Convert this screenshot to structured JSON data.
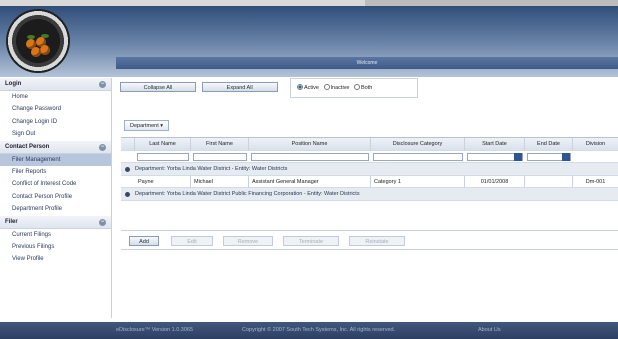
{
  "panel": {
    "title": "Welcome"
  },
  "sidebar": {
    "sections": [
      {
        "title": "Login",
        "items": [
          {
            "label": "Home",
            "active": false
          },
          {
            "label": "Change Password",
            "active": false
          },
          {
            "label": "Change Login ID",
            "active": false
          },
          {
            "label": "Sign Out",
            "active": false
          }
        ]
      },
      {
        "title": "Contact Person",
        "items": [
          {
            "label": "Filer Management",
            "active": true
          },
          {
            "label": "Filer Reports",
            "active": false
          },
          {
            "label": "Conflict of Interest Code",
            "active": false
          },
          {
            "label": "Contact Person Profile",
            "active": false
          },
          {
            "label": "Department Profile",
            "active": false
          }
        ]
      },
      {
        "title": "Filer",
        "items": [
          {
            "label": "Current Filings",
            "active": false
          },
          {
            "label": "Previous Filings",
            "active": false
          },
          {
            "label": "View Profile",
            "active": false
          }
        ]
      }
    ]
  },
  "controls": {
    "collapse_all": "Collapse All",
    "expand_all": "Expand All",
    "status_options": [
      {
        "label": "Active",
        "selected": true
      },
      {
        "label": "Inactive",
        "selected": false
      },
      {
        "label": "Both",
        "selected": false
      }
    ],
    "department_dropdown": "Department"
  },
  "grid": {
    "columns": [
      "Last Name",
      "First Name",
      "Position Name",
      "Disclosure Category",
      "Start Date",
      "End Date",
      "Division"
    ],
    "groups": [
      {
        "label": "Department: Yorba Linda Water District - Entity: Water Districts",
        "rows": [
          [
            "Payne",
            "Michael",
            "Assistant General Manager",
            "Category 1",
            "01/01/2008",
            "",
            "Dm-001"
          ]
        ]
      },
      {
        "label": "Department: Yorba Linda Water District Public Financing Corporation - Entity: Water Districts",
        "rows": []
      }
    ]
  },
  "actions": {
    "add": "Add",
    "edit": "Edit",
    "remove": "Remove",
    "terminate": "Terminate",
    "reinstate": "Reinstate"
  },
  "footer": {
    "product": "eDisclosure™ Version 1.0.3065",
    "copyright": "Copyright © 2007 South Tech Systems, Inc.  All rights reserved.",
    "about": "About Us"
  },
  "colors": {
    "header_dark": "#2f4e7a",
    "active_nav": "#b7c6dc",
    "footer": "#2d4063"
  }
}
